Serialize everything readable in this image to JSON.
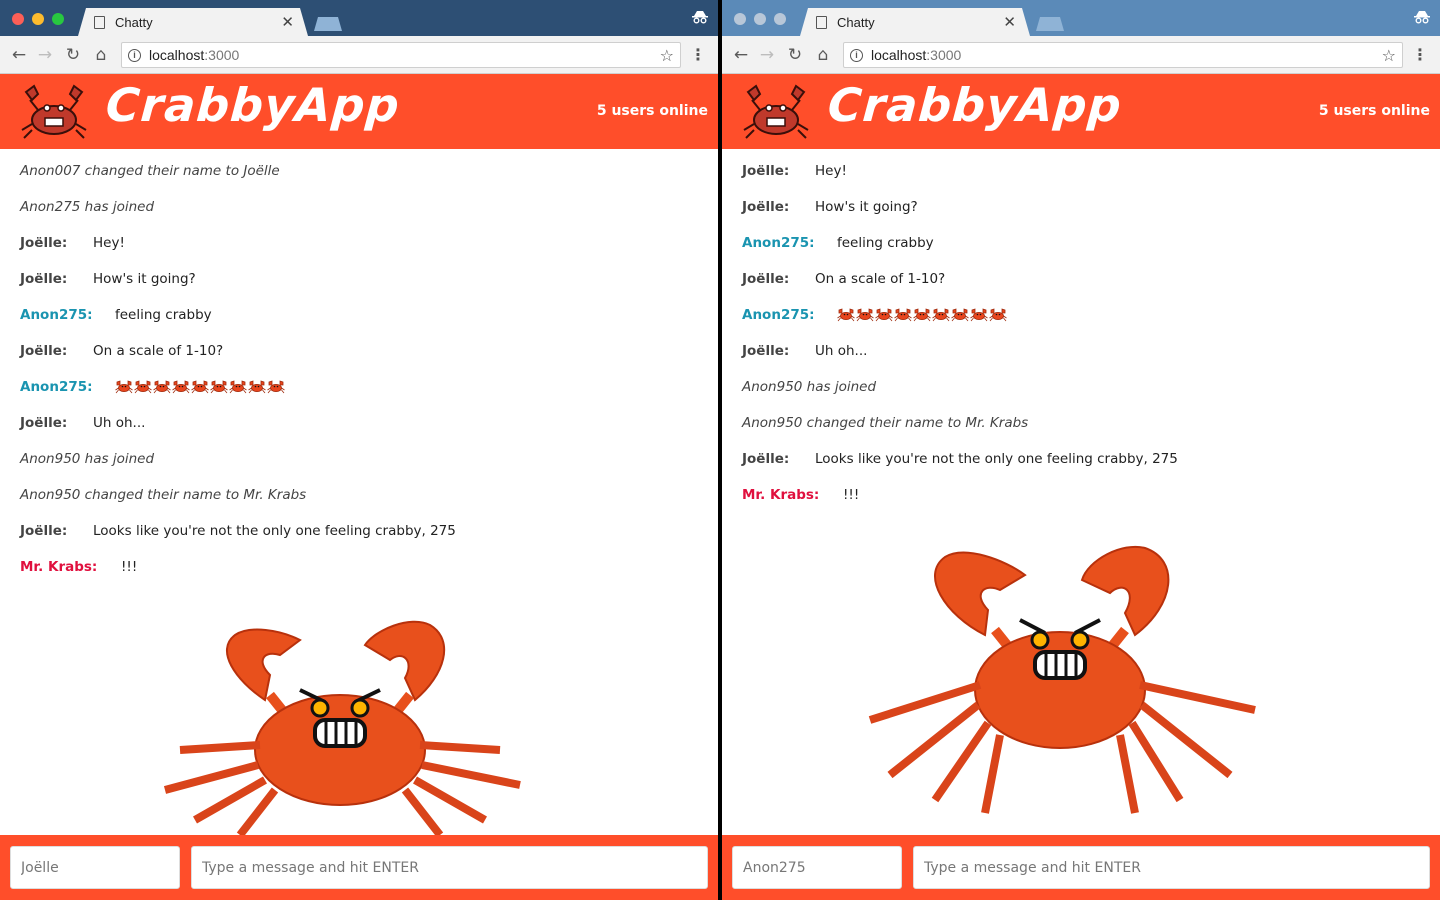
{
  "colors": {
    "brand": "#ff4e2a",
    "user_default": "#444444",
    "user_anon275": "#1a94b0",
    "user_mrkrabs": "#e0103e"
  },
  "windows": [
    {
      "tab_title": "Chatty",
      "url_host": "localhost",
      "url_port": ":3000",
      "app_title": "CrabbyApp",
      "users_online": "5 users online",
      "messages": [
        {
          "type": "system",
          "text": "Anon007 changed their name to Joëlle"
        },
        {
          "type": "system",
          "text": "Anon275 has joined"
        },
        {
          "type": "user",
          "user": "Joëlle:",
          "color": "default",
          "text": "Hey!"
        },
        {
          "type": "user",
          "user": "Joëlle:",
          "color": "default",
          "text": "How's it going?"
        },
        {
          "type": "user",
          "user": "Anon275:",
          "color": "anon275",
          "text": "feeling crabby"
        },
        {
          "type": "user",
          "user": "Joëlle:",
          "color": "default",
          "text": "On a scale of 1-10?"
        },
        {
          "type": "user",
          "user": "Anon275:",
          "color": "anon275",
          "text": "",
          "emoji": "crab",
          "emoji_count": 9
        },
        {
          "type": "user",
          "user": "Joëlle:",
          "color": "default",
          "text": "Uh oh..."
        },
        {
          "type": "system",
          "text": "Anon950 has joined"
        },
        {
          "type": "system",
          "text": "Anon950 changed their name to Mr. Krabs"
        },
        {
          "type": "user",
          "user": "Joëlle:",
          "color": "default",
          "text": "Looks like you're not the only one feeling crabby, 275"
        },
        {
          "type": "user",
          "user": "Mr. Krabs:",
          "color": "mrkrabs",
          "text": "!!!"
        }
      ],
      "username_value": "Joëlle",
      "message_placeholder": "Type a message and hit ENTER"
    },
    {
      "tab_title": "Chatty",
      "url_host": "localhost",
      "url_port": ":3000",
      "app_title": "CrabbyApp",
      "users_online": "5 users online",
      "messages": [
        {
          "type": "user",
          "user": "Joëlle:",
          "color": "default",
          "text": "Hey!"
        },
        {
          "type": "user",
          "user": "Joëlle:",
          "color": "default",
          "text": "How's it going?"
        },
        {
          "type": "user",
          "user": "Anon275:",
          "color": "anon275",
          "text": "feeling crabby"
        },
        {
          "type": "user",
          "user": "Joëlle:",
          "color": "default",
          "text": "On a scale of 1-10?"
        },
        {
          "type": "user",
          "user": "Anon275:",
          "color": "anon275",
          "text": "",
          "emoji": "crab",
          "emoji_count": 9
        },
        {
          "type": "user",
          "user": "Joëlle:",
          "color": "default",
          "text": "Uh oh..."
        },
        {
          "type": "system",
          "text": "Anon950 has joined"
        },
        {
          "type": "system",
          "text": "Anon950 changed their name to Mr. Krabs"
        },
        {
          "type": "user",
          "user": "Joëlle:",
          "color": "default",
          "text": "Looks like you're not the only one feeling crabby, 275"
        },
        {
          "type": "user",
          "user": "Mr. Krabs:",
          "color": "mrkrabs",
          "text": "!!!"
        }
      ],
      "username_value": "Anon275",
      "message_placeholder": "Type a message and hit ENTER"
    }
  ]
}
